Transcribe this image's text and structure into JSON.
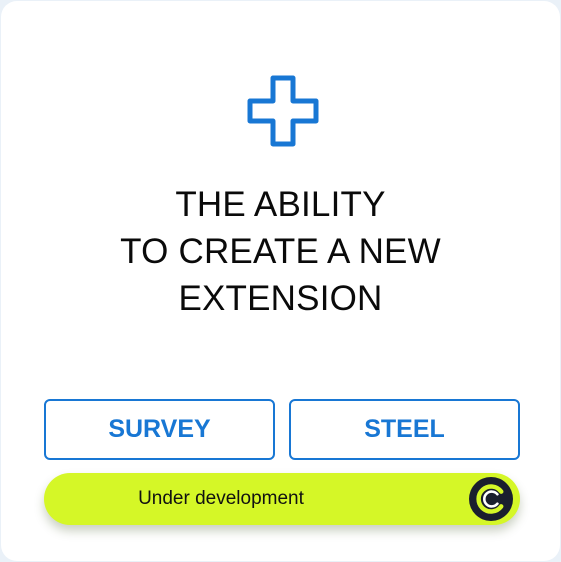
{
  "headline": {
    "line1": "THE ABILITY",
    "line2": "TO CREATE A NEW",
    "line3": "EXTENSION"
  },
  "tags": {
    "survey_label": "SURVEY",
    "steel_label": "STEEL"
  },
  "status": {
    "text": "Under development",
    "logo_icon": "spinner-logo-icon"
  },
  "icons": {
    "main_icon": "plus-icon"
  },
  "colors": {
    "accent": "#1877d4",
    "status_background": "#d5f727",
    "logo_background": "#1a1f2e",
    "text": "#0a0a0a"
  }
}
